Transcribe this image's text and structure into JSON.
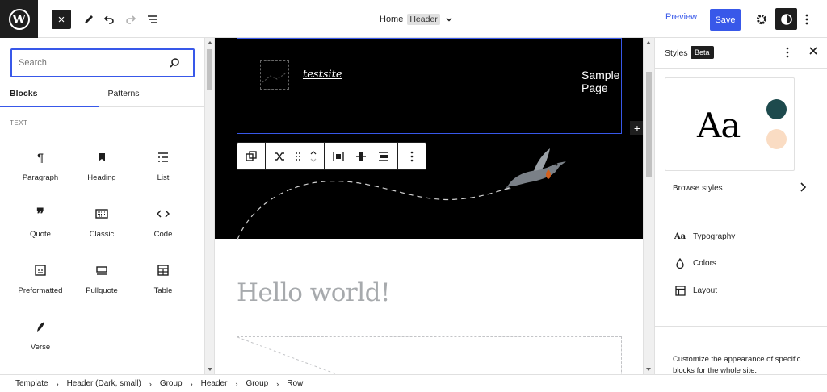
{
  "topbar": {
    "close_label": "×",
    "document": {
      "name": "Home",
      "badge": "Header"
    },
    "preview_label": "Preview",
    "save_label": "Save"
  },
  "inserter": {
    "search_placeholder": "Search",
    "tabs": [
      {
        "label": "Blocks",
        "active": true
      },
      {
        "label": "Patterns",
        "active": false
      }
    ],
    "category": "TEXT",
    "blocks": [
      {
        "label": "Paragraph",
        "icon": "paragraph-icon"
      },
      {
        "label": "Heading",
        "icon": "heading-icon"
      },
      {
        "label": "List",
        "icon": "list-icon"
      },
      {
        "label": "Quote",
        "icon": "quote-icon"
      },
      {
        "label": "Classic",
        "icon": "keyboard-icon"
      },
      {
        "label": "Code",
        "icon": "code-icon"
      },
      {
        "label": "Preformatted",
        "icon": "preformatted-icon"
      },
      {
        "label": "Pullquote",
        "icon": "pullquote-icon"
      },
      {
        "label": "Table",
        "icon": "table-icon"
      },
      {
        "label": "Verse",
        "icon": "verse-icon"
      }
    ]
  },
  "canvas": {
    "site_title": "testsite",
    "nav_item": "Sample Page",
    "post_title": "Hello world!",
    "colors": {
      "header_bg": "#000000",
      "selection": "#3858e9"
    }
  },
  "styles_panel": {
    "title": "Styles",
    "badge": "Beta",
    "preview_text": "Aa",
    "swatches": [
      "#1d4a4d",
      "#fadcc3"
    ],
    "browse_label": "Browse styles",
    "items": [
      {
        "label": "Typography",
        "icon": "typography-icon"
      },
      {
        "label": "Colors",
        "icon": "droplet-icon"
      },
      {
        "label": "Layout",
        "icon": "layout-icon"
      }
    ],
    "description": "Customize the appearance of specific blocks for the whole site."
  },
  "breadcrumb": [
    "Template",
    "Header (Dark, small)",
    "Group",
    "Header",
    "Group",
    "Row"
  ]
}
